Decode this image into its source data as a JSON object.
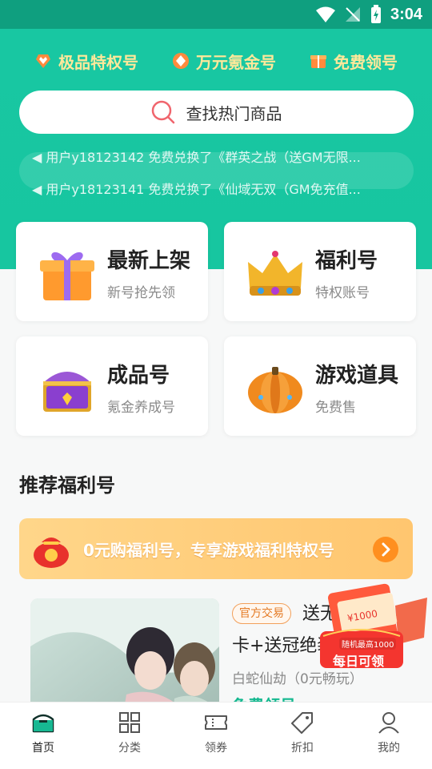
{
  "status": {
    "time": "3:04"
  },
  "perks": [
    {
      "label": "极品特权号",
      "icon": "diamond-heart-icon"
    },
    {
      "label": "万元氪金号",
      "icon": "diamond-icon"
    },
    {
      "label": "免费领号",
      "icon": "gift-box-icon"
    }
  ],
  "search": {
    "placeholder": "查找热门商品"
  },
  "ticker": [
    "用户y18123142 免费兑换了《群英之战（送GM无限...",
    "用户y18123141 免费兑换了《仙域无双（GM免充值..."
  ],
  "categories": [
    {
      "title": "最新上架",
      "subtitle": "新号抢先领",
      "icon": "gift-box-icon"
    },
    {
      "title": "福利号",
      "subtitle": "特权账号",
      "icon": "crown-icon"
    },
    {
      "title": "成品号",
      "subtitle": "氪金养成号",
      "icon": "treasure-chest-icon"
    },
    {
      "title": "游戏道具",
      "subtitle": "免费售",
      "icon": "pumpkin-icon"
    }
  ],
  "section": {
    "title": "推荐福利号"
  },
  "promo": {
    "text": "0元购福利号，专享游戏福利特权号"
  },
  "product": {
    "tag": "官方交易",
    "title_line1": "送无限",
    "title_line2": "卡+送冠绝装",
    "subtitle": "白蛇仙劫（0元畅玩）",
    "cta": "免费领号"
  },
  "floating_badge": {
    "amount": "¥1000",
    "note": "随机最高1000",
    "label": "每日可领"
  },
  "tabs": [
    {
      "label": "首页",
      "icon": "home-icon",
      "active": true
    },
    {
      "label": "分类",
      "icon": "grid-icon",
      "active": false
    },
    {
      "label": "领券",
      "icon": "ticket-icon",
      "active": false
    },
    {
      "label": "折扣",
      "icon": "tag-icon",
      "active": false
    },
    {
      "label": "我的",
      "icon": "user-icon",
      "active": false
    }
  ],
  "colors": {
    "brand": "#18c7a2",
    "accent": "#ff8f1f",
    "perk_text": "#ffe89a"
  }
}
